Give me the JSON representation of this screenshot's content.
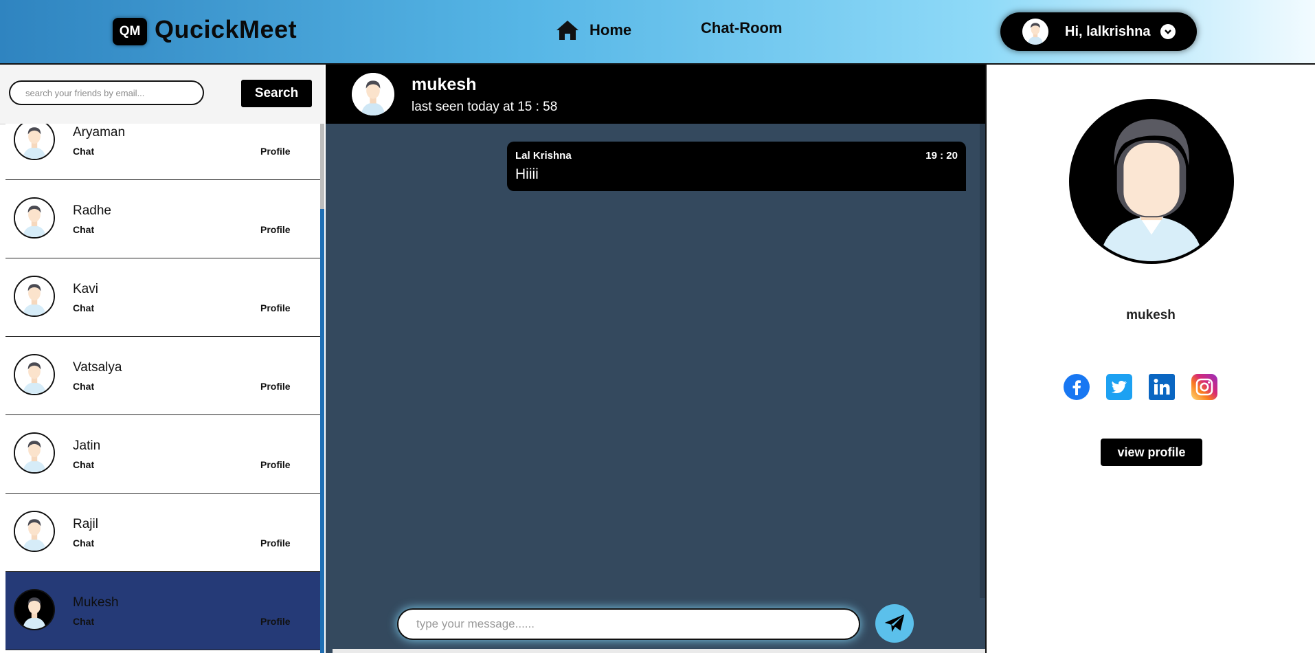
{
  "header": {
    "logo_badge": "QM",
    "app_name": "QucickMeet",
    "nav": {
      "home": "Home",
      "chat_room": "Chat-Room"
    },
    "user_greeting": "Hi, lalkrishna"
  },
  "sidebar": {
    "search_placeholder": "search your friends by email...",
    "search_button": "Search",
    "friends": [
      {
        "name": "Aryaman",
        "chat": "Chat",
        "profile": "Profile"
      },
      {
        "name": "Radhe",
        "chat": "Chat",
        "profile": "Profile"
      },
      {
        "name": "Kavi",
        "chat": "Chat",
        "profile": "Profile"
      },
      {
        "name": "Vatsalya",
        "chat": "Chat",
        "profile": "Profile"
      },
      {
        "name": "Jatin",
        "chat": "Chat",
        "profile": "Profile"
      },
      {
        "name": "Rajil",
        "chat": "Chat",
        "profile": "Profile"
      },
      {
        "name": "Mukesh",
        "chat": "Chat",
        "profile": "Profile",
        "active": true
      }
    ]
  },
  "chat": {
    "contact_name": "mukesh",
    "last_seen": "last seen today at 15 : 58",
    "messages": [
      {
        "sender": "Lal Krishna",
        "time": "19 : 20",
        "text": "Hiiii"
      }
    ],
    "input_placeholder": "type your message......"
  },
  "profile_panel": {
    "name": "mukesh",
    "socials": [
      "facebook-icon",
      "twitter-icon",
      "linkedin-icon",
      "instagram-icon"
    ],
    "view_profile_button": "view profile"
  },
  "colors": {
    "active_item": "#253a77",
    "chat_bg": "#34495e",
    "send_button": "#5bc0eb"
  }
}
